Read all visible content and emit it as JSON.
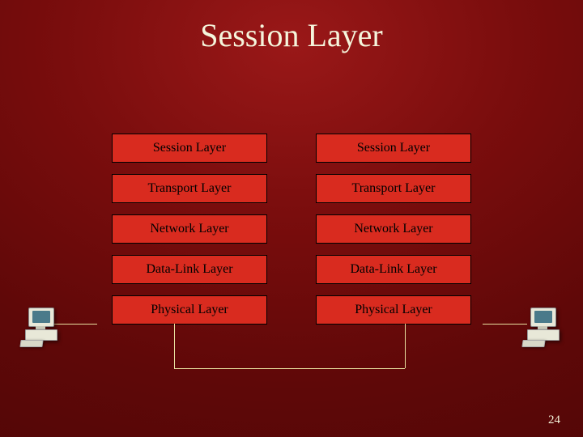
{
  "title": "Session Layer",
  "left_stack": {
    "layer0": "Session Layer",
    "layer1": "Transport Layer",
    "layer2": "Network Layer",
    "layer3": "Data-Link Layer",
    "layer4": "Physical Layer"
  },
  "right_stack": {
    "layer0": "Session Layer",
    "layer1": "Transport Layer",
    "layer2": "Network Layer",
    "layer3": "Data-Link Layer",
    "layer4": "Physical Layer"
  },
  "page_number": "24"
}
